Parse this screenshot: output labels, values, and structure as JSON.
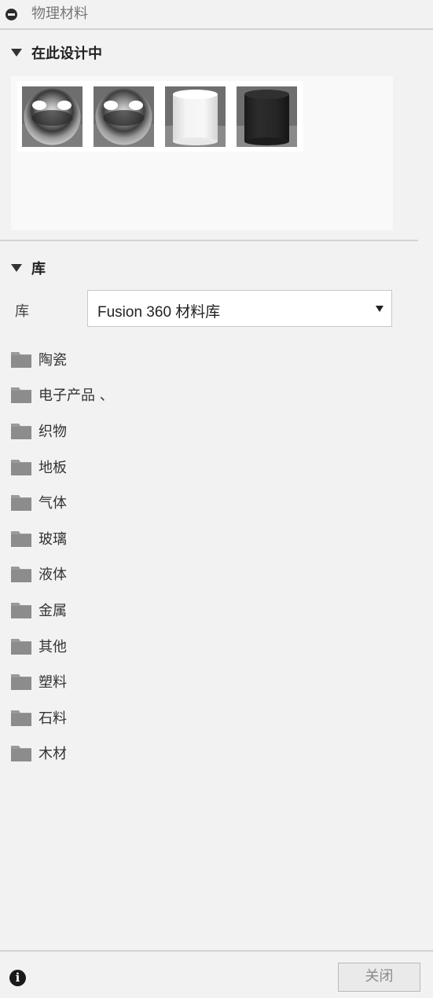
{
  "panel": {
    "title": "物理材料"
  },
  "design_section": {
    "title": "在此设计中",
    "materials": [
      {
        "icon": "chrome-sphere-swatch"
      },
      {
        "icon": "chrome-sphere-swatch"
      },
      {
        "icon": "white-cylinder-swatch"
      },
      {
        "icon": "black-cylinder-swatch"
      }
    ]
  },
  "library_section": {
    "title": "库",
    "library_label": "库",
    "selected_library": "Fusion 360 材料库",
    "folders": [
      {
        "label": "陶瓷"
      },
      {
        "label": "电子产品 、"
      },
      {
        "label": "织物"
      },
      {
        "label": "地板"
      },
      {
        "label": "气体"
      },
      {
        "label": "玻璃"
      },
      {
        "label": "液体"
      },
      {
        "label": "金属"
      },
      {
        "label": "其他"
      },
      {
        "label": "塑料"
      },
      {
        "label": "石料"
      },
      {
        "label": "木材"
      }
    ]
  },
  "footer": {
    "info_icon": "i",
    "close_label": "关闭"
  },
  "colors": {
    "background": "#f2f2f2",
    "divider": "#d2d2d2",
    "folder": "#9a9a9a"
  }
}
